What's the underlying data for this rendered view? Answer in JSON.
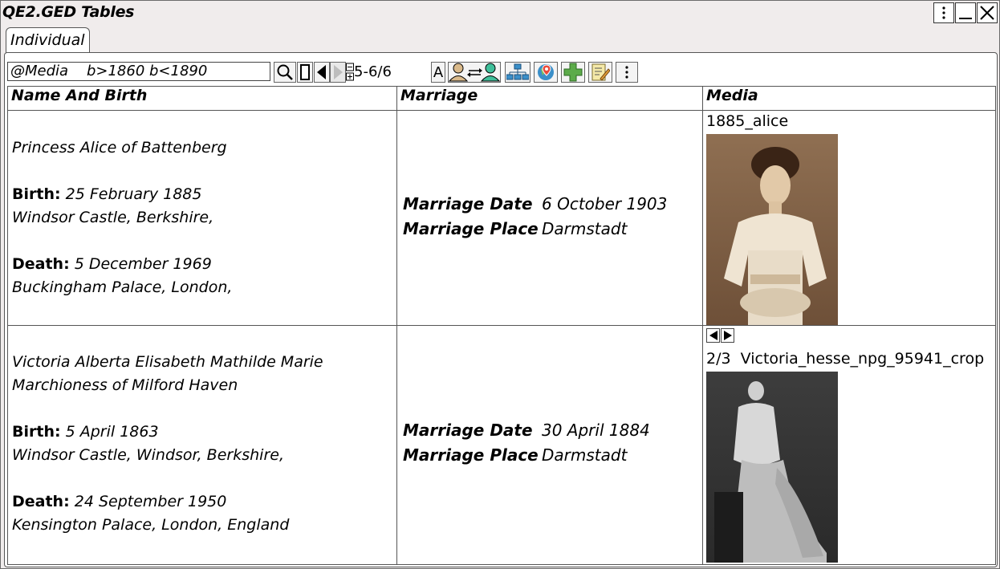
{
  "window": {
    "title": "QE2.GED Tables"
  },
  "tabs": [
    {
      "label": "Individual"
    }
  ],
  "toolbar": {
    "search_value": "@Media    b>1860 b<1890",
    "range": "5-6/6",
    "font_button": "A"
  },
  "table": {
    "columns": [
      "Name And Birth",
      "Marriage",
      "Media"
    ],
    "rows": [
      {
        "name_lines": [
          "Princess Alice of Battenberg"
        ],
        "birth_label": "Birth:",
        "birth_date": "25 February 1885",
        "birth_place": "Windsor Castle, Berkshire,",
        "death_label": "Death:",
        "death_date": "5 December 1969",
        "death_place": "Buckingham Palace, London,",
        "marriage_date_label": "Marriage Date",
        "marriage_date": "6 October 1903",
        "marriage_place_label": "Marriage Place",
        "marriage_place": "Darmstadt",
        "media_caption": "1885_alice",
        "media_counter": ""
      },
      {
        "name_lines": [
          "Victoria Alberta Elisabeth Mathilde Marie",
          "Marchioness of Milford Haven"
        ],
        "birth_label": "Birth:",
        "birth_date": "5 April 1863",
        "birth_place": "Windsor Castle, Windsor, Berkshire,",
        "death_label": "Death:",
        "death_date": "24 September 1950",
        "death_place": "Kensington Palace, London, England",
        "marriage_date_label": "Marriage Date",
        "marriage_date": "30 April 1884",
        "marriage_place_label": "Marriage Place",
        "marriage_place": "Darmstadt",
        "media_caption": "Victoria_hesse_npg_95941_crop",
        "media_counter": "2/3"
      }
    ]
  },
  "icons": {
    "window": [
      "kebab-menu-icon",
      "minimize-icon",
      "close-icon"
    ],
    "toolbar": [
      "search-icon",
      "blank-page-icon",
      "prev-arrow-icon",
      "next-arrow-icon",
      "expand-collapse-icon",
      "relationship-icon",
      "tree-icon",
      "map-pin-icon",
      "add-icon",
      "edit-icon",
      "more-icon"
    ]
  },
  "colors": {
    "accent": "#3a8fc9",
    "photo_sepia": "#8a6a4c",
    "photo_bw": "#555555"
  }
}
